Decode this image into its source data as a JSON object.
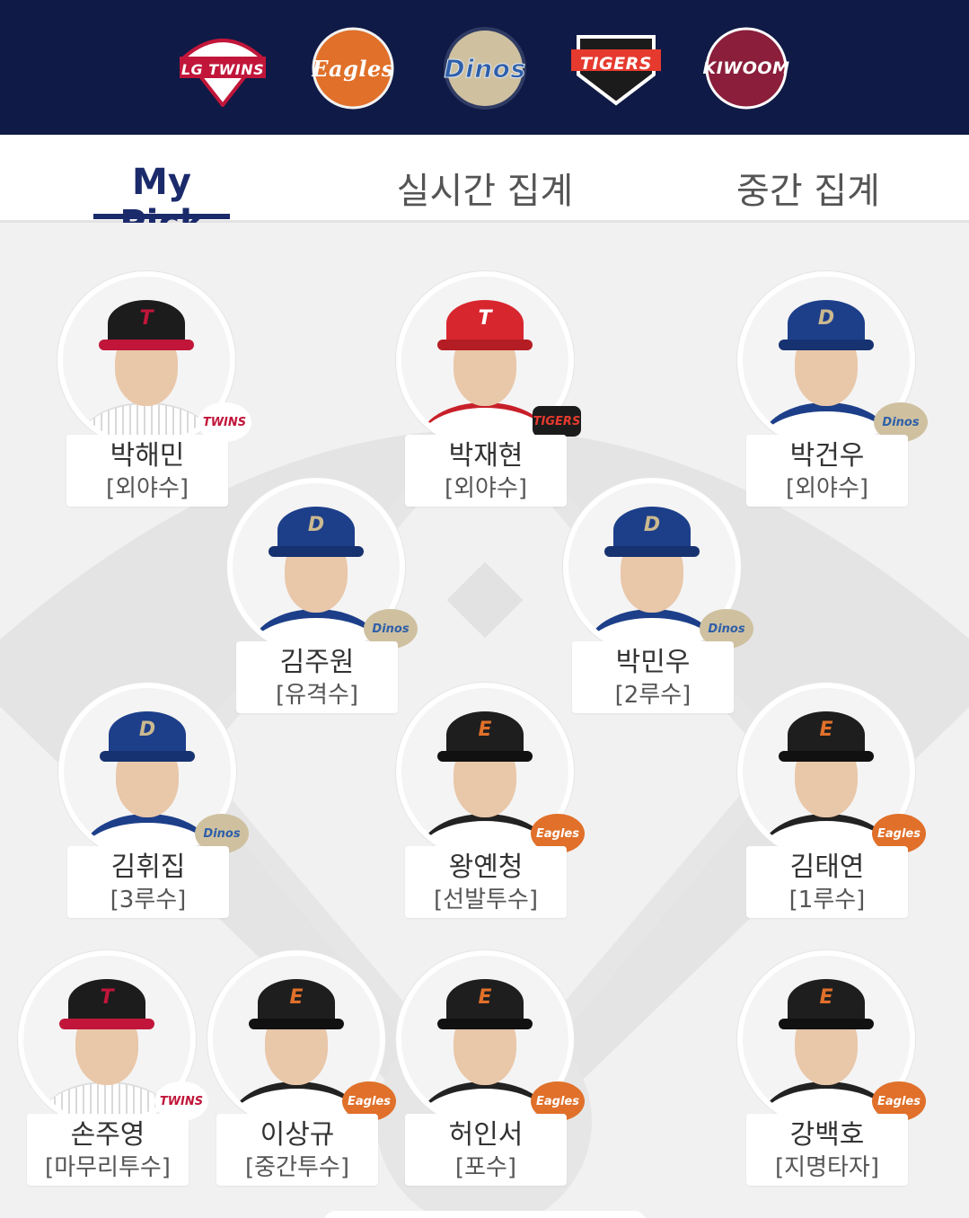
{
  "header": {
    "team_logos": [
      {
        "name": "LG TWINS",
        "color": "#c1163a",
        "bg": "#ffffff"
      },
      {
        "name": "Eagles",
        "color": "#ffffff",
        "bg": "#e0702a"
      },
      {
        "name": "Dinos",
        "color": "#2f5fa8",
        "bg": "#cfc1a0"
      },
      {
        "name": "TIGERS",
        "color": "#e63a2e",
        "bg": "#1b1b1b"
      },
      {
        "name": "KIWOOM",
        "color": "#ffffff",
        "bg": "#8a1e3b"
      }
    ]
  },
  "tabs": [
    {
      "label": "My Pick"
    },
    {
      "label": "실시간 집계"
    },
    {
      "label": "중간 집계"
    }
  ],
  "players": [
    {
      "name": "박해민",
      "position": "[외야수]",
      "team": "TWINS"
    },
    {
      "name": "박재현",
      "position": "[외야수]",
      "team": "TIGERS"
    },
    {
      "name": "박건우",
      "position": "[외야수]",
      "team": "Dinos"
    },
    {
      "name": "김주원",
      "position": "[유격수]",
      "team": "Dinos"
    },
    {
      "name": "박민우",
      "position": "[2루수]",
      "team": "Dinos"
    },
    {
      "name": "김휘집",
      "position": "[3루수]",
      "team": "Dinos"
    },
    {
      "name": "왕옌청",
      "position": "[선발투수]",
      "team": "Eagles"
    },
    {
      "name": "김태연",
      "position": "[1루수]",
      "team": "Eagles"
    },
    {
      "name": "손주영",
      "position": "[마무리투수]",
      "team": "TWINS"
    },
    {
      "name": "이상규",
      "position": "[중간투수]",
      "team": "Eagles"
    },
    {
      "name": "허인서",
      "position": "[포수]",
      "team": "Eagles"
    },
    {
      "name": "강백호",
      "position": "[지명타자]",
      "team": "Eagles"
    }
  ],
  "colors": {
    "header_bg": "#0f1a46",
    "accent": "#1b2a6b",
    "field_bg": "#f1f1f1",
    "field_lines": "#e2e2e2"
  }
}
